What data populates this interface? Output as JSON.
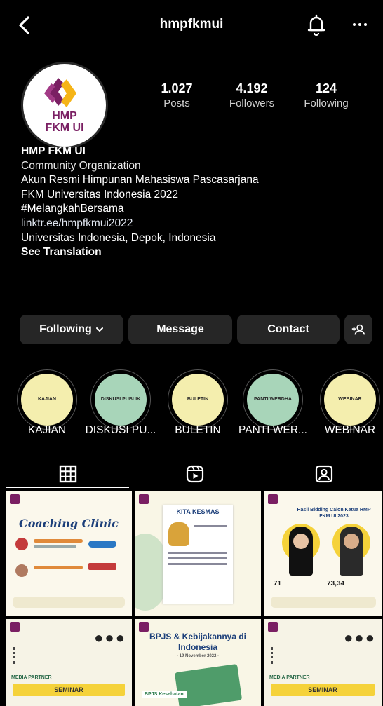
{
  "header": {
    "username": "hmpfkmui"
  },
  "profile": {
    "avatar_text_1": "HMP",
    "avatar_text_2": "FKM UI",
    "stats": [
      {
        "value": "1.027",
        "label": "Posts"
      },
      {
        "value": "4.192",
        "label": "Followers"
      },
      {
        "value": "124",
        "label": "Following"
      }
    ],
    "bio": {
      "name": "HMP FKM UI",
      "category": "Community Organization",
      "line1": "Akun Resmi Himpunan Mahasiswa Pascasarjana",
      "line2": "FKM Universitas Indonesia 2022",
      "hashtag": "#MelangkahBersama",
      "link": "linktr.ee/hmpfkmui2022",
      "location": "Universitas Indonesia, Depok, Indonesia",
      "translate": "See Translation"
    }
  },
  "actions": {
    "following": "Following",
    "message": "Message",
    "contact": "Contact"
  },
  "highlights": [
    {
      "title": "KAJIAN",
      "inner": "KAJIAN",
      "color": "#f4eeae"
    },
    {
      "title": "DISKUSI PU...",
      "inner": "DISKUSI PUBLIK",
      "color": "#a8d5b9"
    },
    {
      "title": "BULETIN",
      "inner": "BULETIN",
      "color": "#f4eeae"
    },
    {
      "title": "PANTI WER...",
      "inner": "PANTI WERDHA",
      "color": "#a8d5b9"
    },
    {
      "title": "WEBINAR",
      "inner": "WEBINAR",
      "color": "#f4eeae"
    }
  ],
  "posts": {
    "p1_title": "Coaching Clinic",
    "p2_title": "KITA KESMAS",
    "p3_title": "Hasil Bidding Calon Ketua HMP FKM UI 2023",
    "p3_score_a": "71",
    "p3_score_b": "73,34",
    "p4_badge": "MEDIA PARTNER",
    "p4_label": "SEMINAR",
    "p5_title": "BPJS & Kebijakannya di Indonesia",
    "p5_date": "- 19 November 2022 -",
    "p5_logo": "BPJS Kesehatan",
    "p6_badge": "MEDIA PARTNER",
    "p6_label": "SEMINAR"
  },
  "colors": {
    "background": "#000000",
    "button": "#262626",
    "brand_purple": "#7a1f63",
    "brand_yellow": "#f5b417"
  }
}
